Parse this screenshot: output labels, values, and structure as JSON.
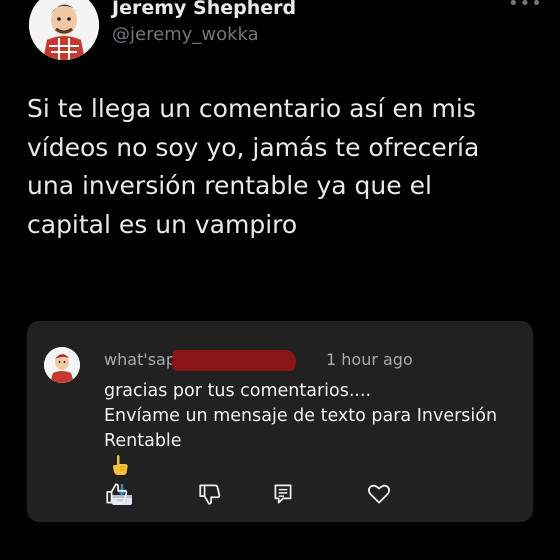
{
  "tweet": {
    "author": {
      "display_name": "Jeremy Shepherd",
      "handle": "@jeremy_wokka",
      "avatar_icon": "cartoon-avatar-icon"
    },
    "more_icon": "more-options-icon",
    "text_lines": [
      "Si te llega un comentario así en mis",
      "vídeos no soy yo, jamás te ofrecería",
      "una inversión rentable ya que el",
      "capital es un vampiro"
    ]
  },
  "embedded_comment": {
    "author": "what'sapp",
    "author_redacted": true,
    "time": "1 hour ago",
    "body_lines": [
      "gracias por tus comentarios....",
      "Envíame un mensaje de texto para Inversión",
      "Rentable"
    ],
    "emojis": [
      "pointing-hand-icon",
      "inbox-tray-icon"
    ],
    "actions": [
      "like-icon",
      "dislike-icon",
      "reply-icon",
      "heart-icon"
    ]
  },
  "colors": {
    "background": "#000000",
    "card": "#212121",
    "text": "#e7e9ea",
    "secondary": "#71767b",
    "redaction": "#8b1414"
  }
}
